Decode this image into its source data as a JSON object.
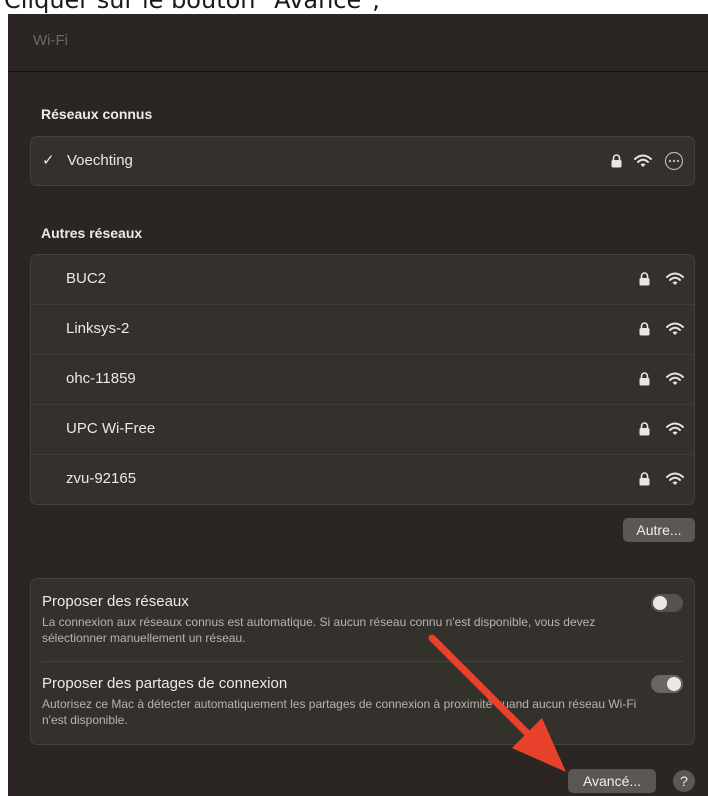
{
  "caption": "Cliquer sur le bouton \"Avancé\";",
  "window": {
    "title": "Wi-Fi"
  },
  "known": {
    "heading": "Réseaux connus",
    "network": {
      "check": "✓",
      "name": "Voechting"
    }
  },
  "others": {
    "heading": "Autres réseaux",
    "networks": [
      {
        "name": "BUC2"
      },
      {
        "name": "Linksys-2"
      },
      {
        "name": "ohc-11859"
      },
      {
        "name": "UPC Wi-Free"
      },
      {
        "name": "zvu-92165"
      }
    ],
    "other_button": "Autre..."
  },
  "options": [
    {
      "title": "Proposer des réseaux",
      "desc": "La connexion aux réseaux connus est automatique. Si aucun réseau connu n'est disponible, vous devez sélectionner manuellement un réseau.",
      "enabled": false
    },
    {
      "title": "Proposer des partages de connexion",
      "desc": "Autorisez ce Mac à détecter automatiquement les partages de connexion à proximité quand aucun réseau Wi-Fi n'est disponible.",
      "enabled": true
    }
  ],
  "footer": {
    "advanced_button": "Avancé...",
    "help_button": "?"
  },
  "colors": {
    "background": "#2b2623",
    "arrow": "#e8412c"
  },
  "icons": {
    "lock": "lock-icon",
    "wifi": "wifi-icon",
    "more": "more-icon"
  }
}
